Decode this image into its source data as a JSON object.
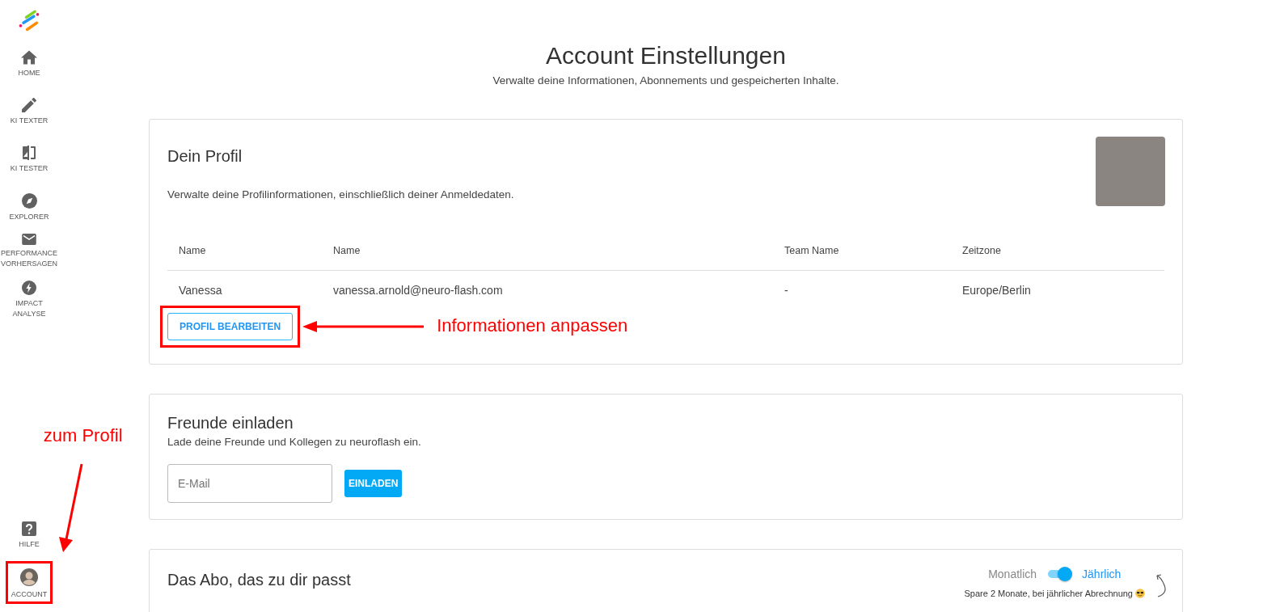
{
  "sidebar": {
    "items": [
      {
        "kind": "home",
        "label": "HOME"
      },
      {
        "kind": "pencil",
        "label": "KI TEXTER"
      },
      {
        "kind": "compare",
        "label": "KI TESTER"
      },
      {
        "kind": "compass",
        "label": "EXPLORER"
      },
      {
        "kind": "mail",
        "label": "PERFORMANCE VORHERSAGEN"
      },
      {
        "kind": "bolt",
        "label": "IMPACT ANALYSE"
      }
    ],
    "bottom_items": [
      {
        "kind": "help",
        "label": "HILFE"
      },
      {
        "kind": "avatar",
        "label": "ACCOUNT"
      }
    ]
  },
  "page": {
    "title": "Account Einstellungen",
    "subtitle": "Verwalte deine Informationen, Abonnements und gespeicherten Inhalte."
  },
  "profile": {
    "title": "Dein Profil",
    "description": "Verwalte deine Profilinformationen, einschließlich deiner Anmeldedaten.",
    "columns": [
      "Name",
      "Name",
      "Team Name",
      "Zeitzone"
    ],
    "row": [
      "Vanessa",
      "vanessa.arnold@neuro-flash.com",
      "-",
      "Europe/Berlin"
    ],
    "edit_button": "PROFIL BEARBEITEN"
  },
  "invite": {
    "title": "Freunde einladen",
    "description": "Lade deine Freunde und Kollegen zu neuroflash ein.",
    "email_placeholder": "E-Mail",
    "button": "EINLADEN"
  },
  "subscription": {
    "title": "Das Abo, das zu dir passt",
    "monthly": "Monatlich",
    "yearly": "Jährlich",
    "yearly_on": true,
    "note": "Spare 2 Monate, bei jährlicher Abrechnung"
  },
  "annotations": {
    "profile_note": "Informationen anpassen",
    "account_note": "zum Profil"
  }
}
